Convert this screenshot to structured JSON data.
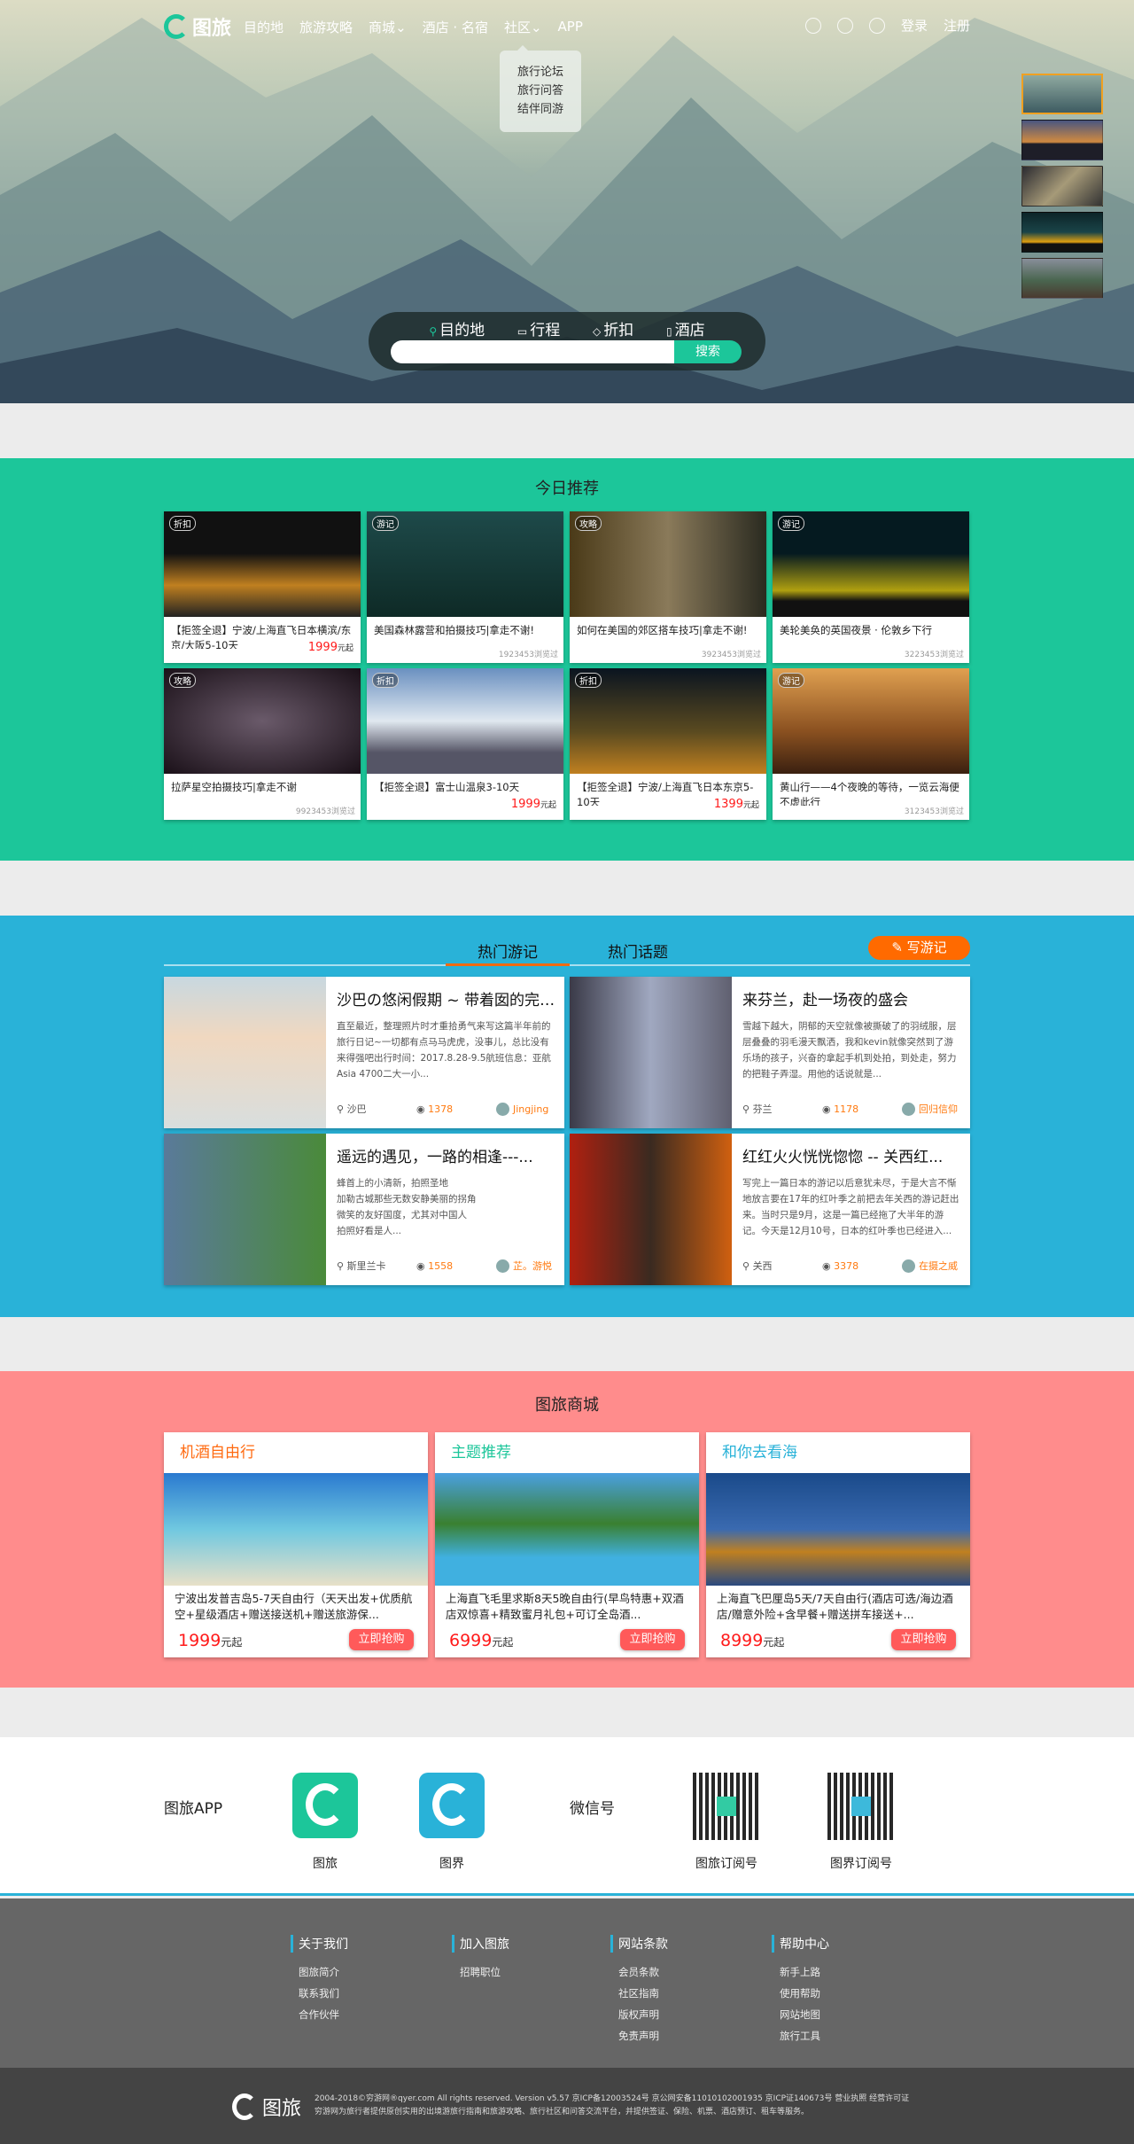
{
  "header": {
    "logo": "图旅",
    "nav": [
      "目的地",
      "旅游攻略",
      "商城",
      "酒店 · 名宿",
      "社区",
      "APP"
    ],
    "login": "登录",
    "register": "注册",
    "community_menu": [
      "旅行论坛",
      "旅行问答",
      "结伴同游"
    ]
  },
  "search": {
    "tabs": [
      "目的地",
      "行程",
      "折扣",
      "酒店"
    ],
    "placeholder": "",
    "button": "搜索"
  },
  "today": {
    "title": "今日推荐",
    "cards": [
      {
        "tag": "折扣",
        "title": "【拒签全退】宁波/上海直飞日本横滨/东京/大阪5-10天",
        "price": "1999",
        "unit": "元起"
      },
      {
        "tag": "游记",
        "title": "美国森林露营和拍摄技巧|拿走不谢!",
        "views": "1923453浏览过"
      },
      {
        "tag": "攻略",
        "title": "如何在美国的郊区搭车技巧|拿走不谢!",
        "views": "3923453浏览过"
      },
      {
        "tag": "游记",
        "title": "美轮美奂的英国夜景 · 伦敦乡下行",
        "views": "3223453浏览过"
      },
      {
        "tag": "攻略",
        "title": "拉萨星空拍摄技巧|拿走不谢",
        "views": "9923453浏览过"
      },
      {
        "tag": "折扣",
        "title": "【拒签全退】富士山温泉3-10天",
        "price": "1999",
        "unit": "元起"
      },
      {
        "tag": "折扣",
        "title": "【拒签全退】宁波/上海直飞日本东京5-10天",
        "price": "1399",
        "unit": "元起"
      },
      {
        "tag": "游记",
        "title": "黄山行——4个夜晚的等待，一览云海便不虚此行",
        "views": "3123453浏览过"
      }
    ]
  },
  "hot": {
    "tabs": [
      "热门游记",
      "热门话题"
    ],
    "write": "写游记",
    "cards": [
      {
        "title": "沙巴の悠闲假期 ~ 带着囡的完全...",
        "desc": "直至最近，整理照片时才重拾勇气来写这篇半年前的旅行日记~一切都有点马马虎虎，没事儿，总比没有来得强吧出行时间：2017.8.28-9.5航班信息：亚航Asia  4700二大一小...",
        "place": "沙巴",
        "views": "1378",
        "author": "Jingjing"
      },
      {
        "title": "来芬兰，赴一场夜的盛会",
        "desc": "雪越下越大，阴郁的天空就像被撕破了的羽绒服，层层叠叠的羽毛漫天飘洒，我和kevin就像突然到了游乐场的孩子，兴奋的拿起手机到处拍，到处走，努力的把鞋子弄湿。用他的话说就是...",
        "place": "芬兰",
        "views": "1178",
        "author": "回归信仰"
      },
      {
        "title": "遥远的遇见，一路的相逢---...",
        "desc": "蜂首上的小清新，拍照圣地\n加勒古城那些无数安静美丽的拐角\n微笑的友好国度，尤其对中国人\n拍照好看是人...",
        "place": "斯里兰卡",
        "views": "1558",
        "author": "芷。游悦"
      },
      {
        "title": "红红火火恍恍惚惚 -- 关西红...",
        "desc": "写完上一篇日本的游记以后意犹未尽，于是大言不惭地放言要在17年的红叶季之前把去年关西的游记赶出来。当时只是9月，这是一篇已经拖了大半年的游记。今天是12月10号，日本的红叶季也已经进入...",
        "place": "关西",
        "views": "3378",
        "author": "在摄之威"
      }
    ]
  },
  "shop": {
    "title": "图旅商城",
    "cards": [
      {
        "header": "机酒自由行",
        "color": "#ff6a10",
        "title": "宁波出发普吉岛5-7天自由行（天天出发+优质航空+星级酒店+赠送接送机+赠送旅游保...",
        "price": "1999",
        "unit": "元起",
        "button": "立即抢购"
      },
      {
        "header": "主题推荐",
        "color": "#1cc69a",
        "title": "上海直飞毛里求斯8天5晚自由行(早鸟特惠+双酒店双惊喜+精致蜜月礼包+可订全岛酒...",
        "price": "6999",
        "unit": "元起",
        "button": "立即抢购"
      },
      {
        "header": "和你去看海",
        "color": "#29b2d8",
        "title": "上海直飞巴厘岛5天/7天自由行(酒店可选/海边酒店/赠意外险+含早餐+赠送拼车接送+...",
        "price": "8999",
        "unit": "元起",
        "button": "立即抢购"
      }
    ]
  },
  "apps": {
    "label": "图旅APP",
    "items": [
      "图旅",
      "图界"
    ],
    "wechat_label": "微信号",
    "qr": [
      "图旅订阅号",
      "图界订阅号"
    ]
  },
  "footer": {
    "cols": [
      {
        "title": "关于我们",
        "items": [
          "图旅简介",
          "联系我们",
          "合作伙伴"
        ]
      },
      {
        "title": "加入图旅",
        "items": [
          "招聘职位"
        ]
      },
      {
        "title": "网站条款",
        "items": [
          "会员条款",
          "社区指南",
          "版权声明",
          "免责声明"
        ]
      },
      {
        "title": "帮助中心",
        "items": [
          "新手上路",
          "使用帮助",
          "网站地图",
          "旅行工具"
        ]
      }
    ],
    "logo": "图旅",
    "copyright": "2004-2018©穷游网®qyer.com All rights reserved. Version v5.57  京ICP备12003524号  京公网安备11010102001935  京ICP证140673号  营业执照  经营许可证",
    "desc": "穷游网为旅行者提供原创实用的出境游旅行指南和旅游攻略、旅行社区和问答交流平台，并提供签证、保险、机票、酒店预订、租车等服务。"
  },
  "colors": {
    "green": "#1cc69a",
    "blue": "#29b2d8",
    "pink": "#ff8c8c",
    "orange": "#ff6a00"
  }
}
